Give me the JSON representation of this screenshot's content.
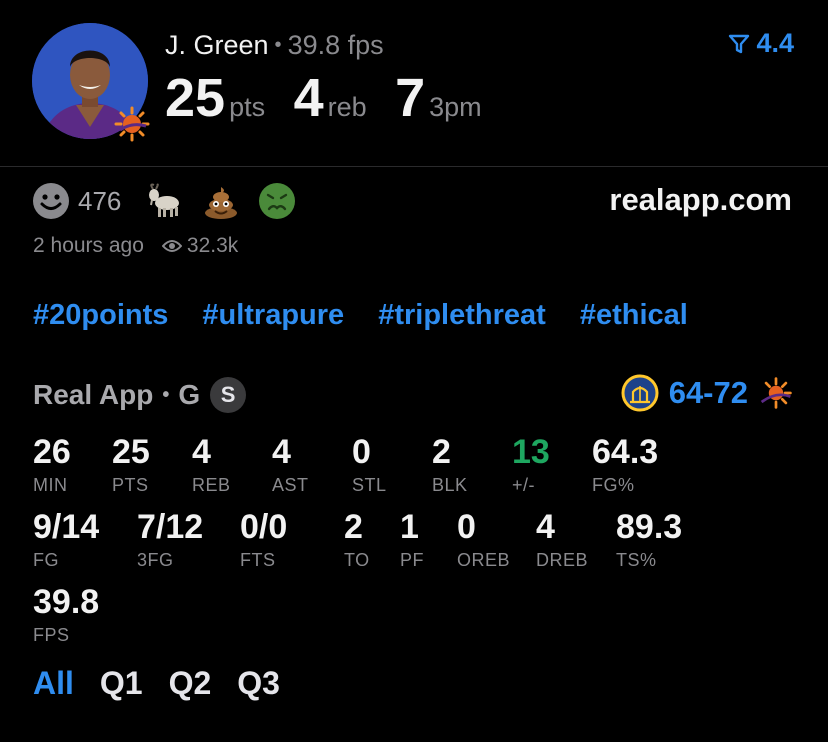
{
  "player": {
    "name": "J. Green",
    "fps_label": "39.8 fps",
    "headline": [
      {
        "value": "25",
        "unit": "pts"
      },
      {
        "value": "4",
        "unit": "reb"
      },
      {
        "value": "7",
        "unit": "3pm"
      }
    ],
    "rating": "4.4"
  },
  "reactions": {
    "count": "476",
    "emojis": [
      "goat-emoji",
      "poop-emoji",
      "nauseated-emoji"
    ]
  },
  "post": {
    "time_ago": "2 hours ago",
    "views": "32.3k",
    "site": "realapp.com"
  },
  "tags": [
    "#20points",
    "#ultrapure",
    "#triplethreat",
    "#ethical"
  ],
  "game": {
    "league": "Real App",
    "position": "G",
    "badge": "S",
    "score": "64-72"
  },
  "stats_row1": [
    {
      "value": "26",
      "label": "MIN"
    },
    {
      "value": "25",
      "label": "PTS"
    },
    {
      "value": "4",
      "label": "REB"
    },
    {
      "value": "4",
      "label": "AST"
    },
    {
      "value": "0",
      "label": "STL"
    },
    {
      "value": "2",
      "label": "BLK"
    },
    {
      "value": "13",
      "label": "+/-"
    },
    {
      "value": "64.3",
      "label": "FG%"
    }
  ],
  "stats_row2": [
    {
      "value": "9/14",
      "label": "FG"
    },
    {
      "value": "7/12",
      "label": "3FG"
    },
    {
      "value": "0/0",
      "label": "FTS"
    },
    {
      "value": "2",
      "label": "TO"
    },
    {
      "value": "1",
      "label": "PF"
    },
    {
      "value": "0",
      "label": "OREB"
    },
    {
      "value": "4",
      "label": "DREB"
    },
    {
      "value": "89.3",
      "label": "TS%"
    }
  ],
  "stats_row3": [
    {
      "value": "39.8",
      "label": "FPS"
    }
  ],
  "quarters": [
    "All",
    "Q1",
    "Q2",
    "Q3"
  ],
  "colors": {
    "accent": "#2f8df0",
    "positive": "#1ea760",
    "muted": "#8a8a8e",
    "background": "#000000"
  }
}
